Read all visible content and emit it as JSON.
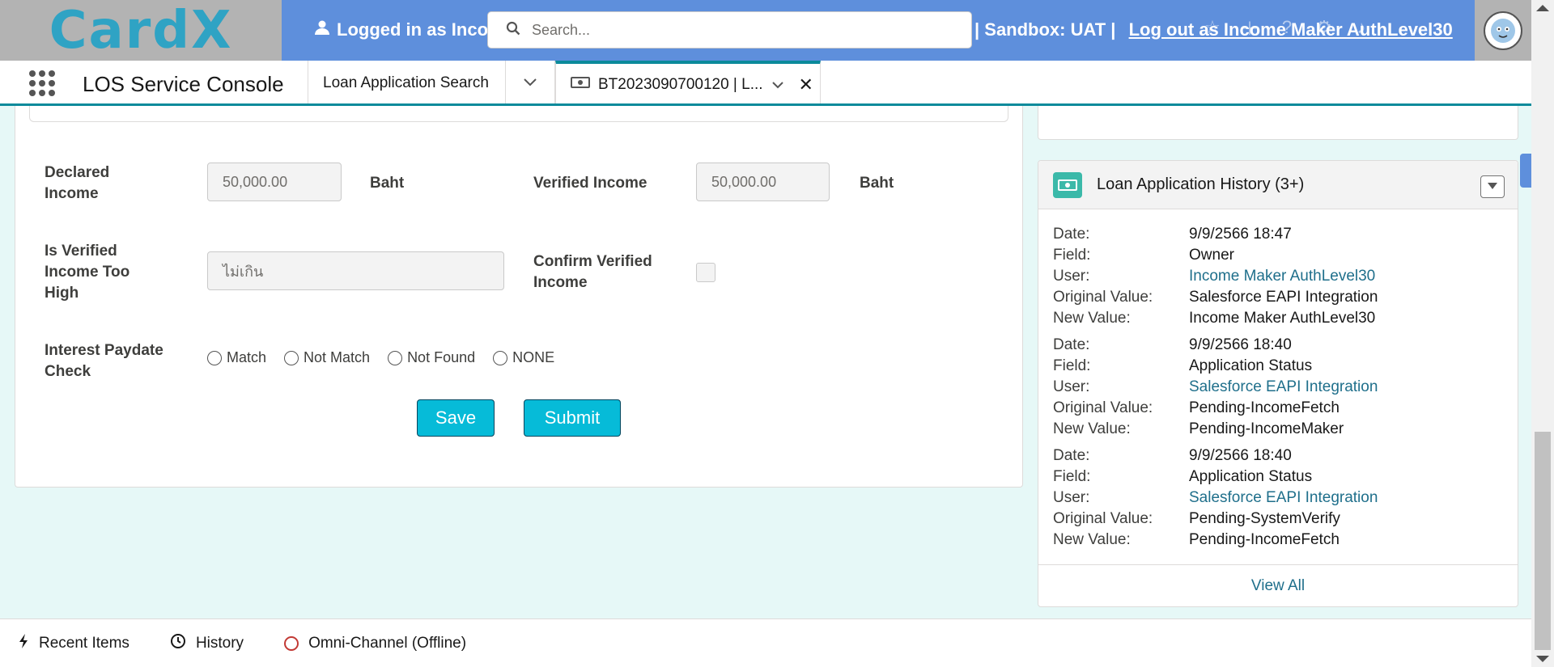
{
  "header": {
    "logo": "CardX",
    "logged_in_text": "Logged in as Inco",
    "sandbox_text": "| Sandbox: UAT |",
    "logout_text": "Log out as Income Maker AuthLevel30",
    "search_placeholder": "Search..."
  },
  "nav": {
    "app_name": "LOS Service Console",
    "tab_search": "Loan Application Search",
    "tab_active": "BT2023090700120 | L..."
  },
  "form": {
    "declared_income_label": "Declared Income",
    "declared_income_value": "50,000.00",
    "declared_unit": "Baht",
    "verified_income_label": "Verified Income",
    "verified_income_value": "50,000.00",
    "verified_unit": "Baht",
    "too_high_label": "Is Verified Income Too High",
    "too_high_value": "ไม่เกิน",
    "confirm_label": "Confirm Verified Income",
    "paydate_label": "Interest Paydate Check",
    "radio_options": [
      "Match",
      "Not Match",
      "Not Found",
      "NONE"
    ],
    "save_label": "Save",
    "submit_label": "Submit"
  },
  "history": {
    "title": "Loan Application History (3+)",
    "keys": {
      "date": "Date:",
      "field": "Field:",
      "user": "User:",
      "original": "Original Value:",
      "new": "New Value:"
    },
    "entries": [
      {
        "date": "9/9/2566 18:47",
        "field": "Owner",
        "user": "Income Maker AuthLevel30",
        "original": "Salesforce EAPI Integration",
        "new": "Income Maker AuthLevel30"
      },
      {
        "date": "9/9/2566 18:40",
        "field": "Application Status",
        "user": "Salesforce EAPI Integration",
        "original": "Pending-IncomeFetch",
        "new": "Pending-IncomeMaker"
      },
      {
        "date": "9/9/2566 18:40",
        "field": "Application Status",
        "user": "Salesforce EAPI Integration",
        "original": "Pending-SystemVerify",
        "new": "Pending-IncomeFetch"
      }
    ],
    "view_all": "View All"
  },
  "utility": {
    "recent_items": "Recent Items",
    "history": "History",
    "omni_channel": "Omni-Channel (Offline)"
  },
  "colors": {
    "banner": "#5e8fdc",
    "accent": "#06bbd8",
    "link": "#1f6f8b",
    "background": "#e6f8f7"
  }
}
